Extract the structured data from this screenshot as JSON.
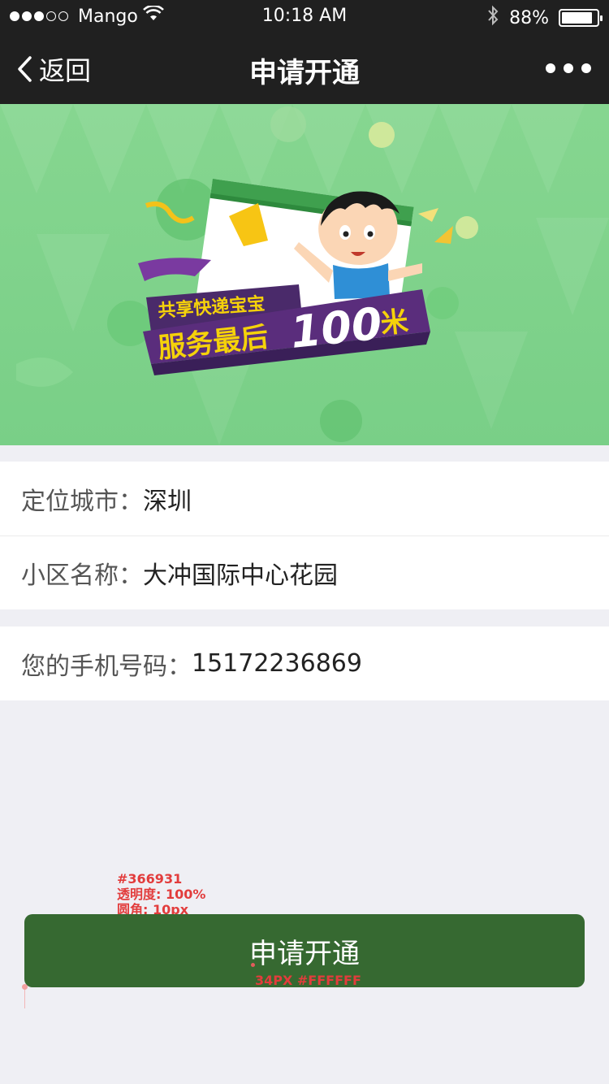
{
  "status_bar": {
    "carrier": "Mango",
    "time": "10:18 AM",
    "battery_percent": "88%",
    "battery_level": 0.88,
    "signal_dots_filled": 3,
    "signal_dots_total": 5,
    "icons": [
      "wifi-icon",
      "bluetooth-icon",
      "battery-icon"
    ]
  },
  "nav": {
    "back_label": "返回",
    "title": "申请开通",
    "more_icon": "more-dots-icon"
  },
  "banner": {
    "line1": "共享快递宝宝",
    "line2": "服务最后",
    "number": "100",
    "unit": "米",
    "colors": {
      "background": "#7fd48e",
      "ribbon": "#4a2a6a",
      "text_yellow": "#f5d20a"
    }
  },
  "form": {
    "city_label": "定位城市：",
    "city_value": "深圳",
    "community_label": "小区名称：",
    "community_value": "大冲国际中心花园",
    "phone_label": "您的手机号码：",
    "phone_value": "15172236869"
  },
  "submit_button": {
    "label": "申请开通",
    "color": "#366931"
  },
  "annotations": {
    "color_note": "#366931",
    "opacity_note": "透明度: 100%",
    "radius_note": "圆角: 10px",
    "font_note": "34PX #FFFFFF"
  }
}
